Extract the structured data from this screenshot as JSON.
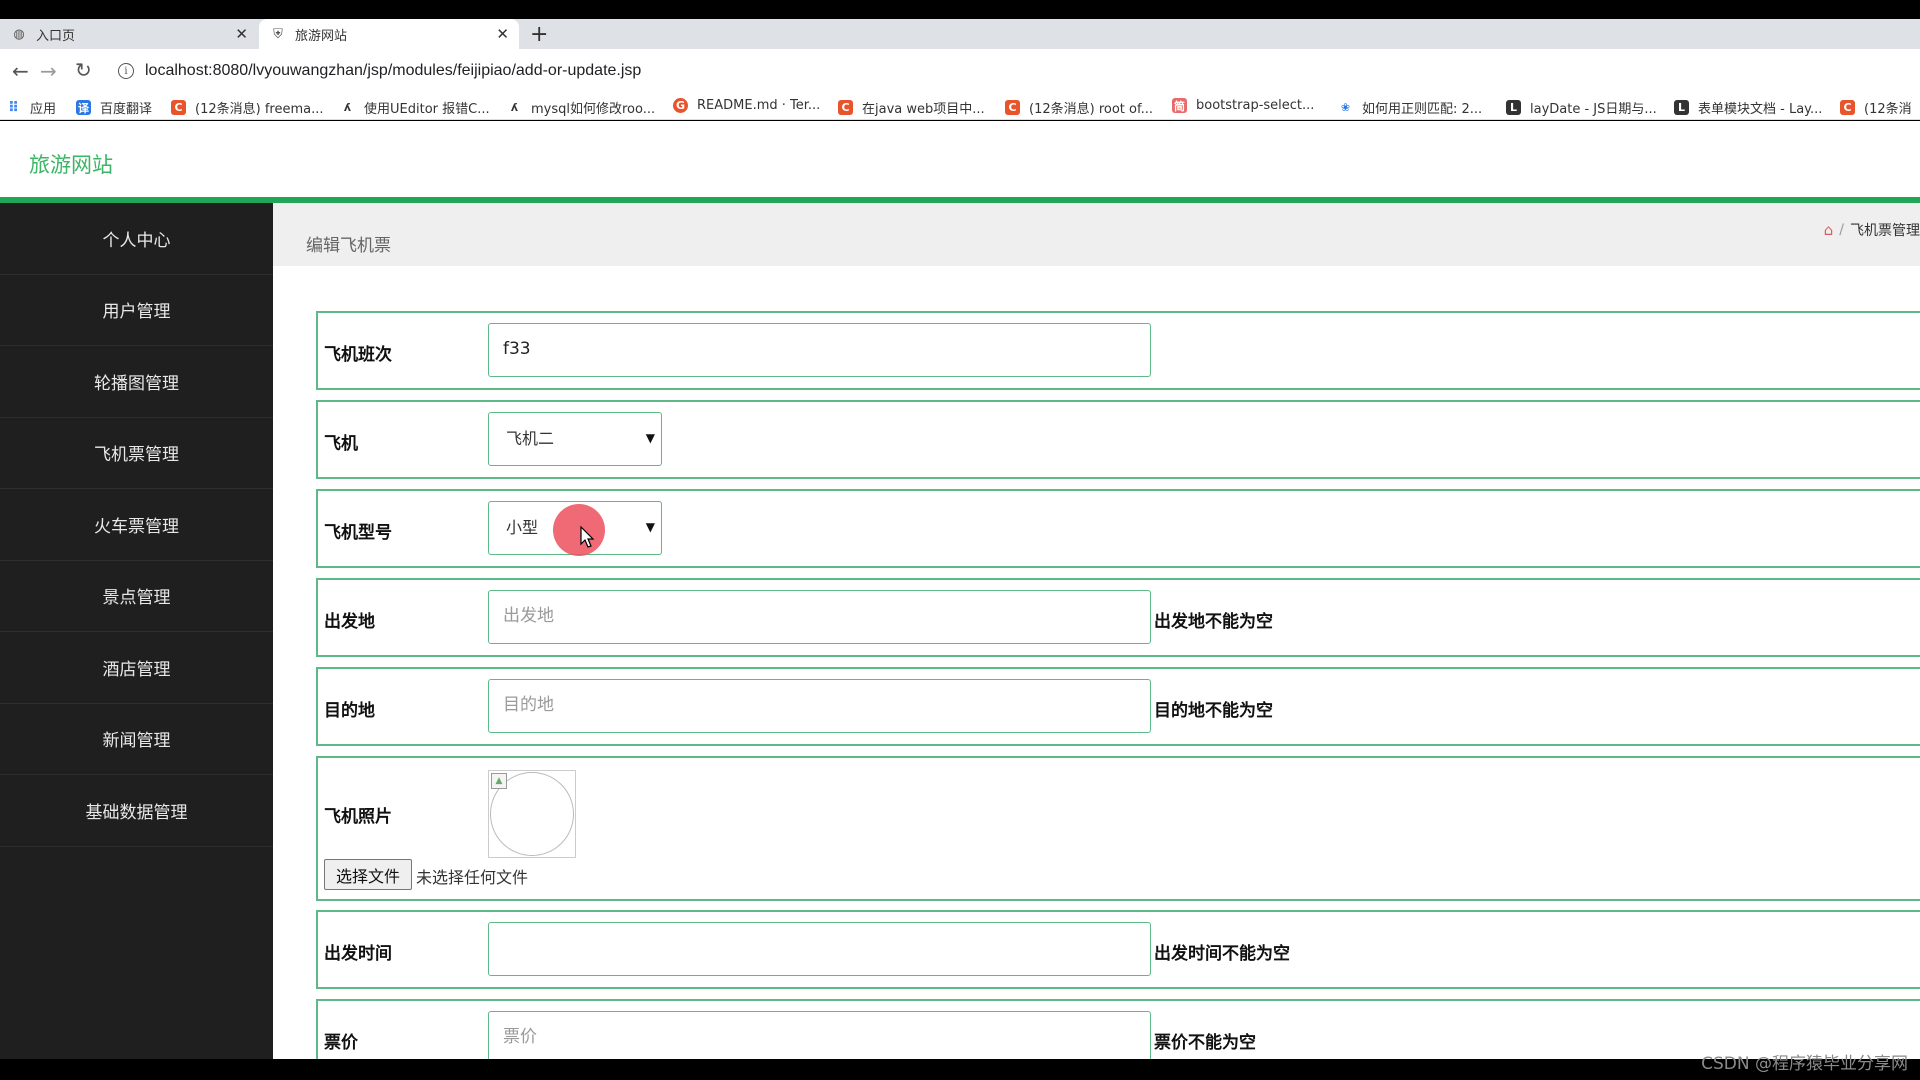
{
  "browser": {
    "tabs": [
      {
        "title": "入口页",
        "icon": "globe-icon"
      },
      {
        "title": "旅游网站",
        "icon": "shield-icon"
      }
    ],
    "new_tab": "+",
    "close_glyph": "✕",
    "url": "localhost:8080/lvyouwangzhan/jsp/modules/feijipiao/add-or-update.jsp",
    "bookmarks": [
      {
        "label": "应用",
        "icon": "apps-grid-icon"
      },
      {
        "label": "百度翻译",
        "icon": "baidu-translate-icon"
      },
      {
        "label": "(12条消息) freema...",
        "icon": "csdn-icon"
      },
      {
        "label": "使用UEditor 报错C...",
        "icon": "link-icon"
      },
      {
        "label": "mysql如何修改roo...",
        "icon": "link-icon"
      },
      {
        "label": "README.md · Ter...",
        "icon": "gitee-icon"
      },
      {
        "label": "在java web项目中...",
        "icon": "csdn-icon"
      },
      {
        "label": "(12条消息) root of...",
        "icon": "csdn-icon"
      },
      {
        "label": "bootstrap-select...",
        "icon": "doc-icon"
      },
      {
        "label": "如何用正则匹配: 2...",
        "icon": "baidu-icon"
      },
      {
        "label": "layDate - JS日期与...",
        "icon": "layui-icon"
      },
      {
        "label": "表单模块文档 - Lay...",
        "icon": "layui-icon"
      },
      {
        "label": "(12条消",
        "icon": "csdn-icon"
      }
    ]
  },
  "app": {
    "logo": "旅游网站",
    "sidebar": [
      "个人中心",
      "用户管理",
      "轮播图管理",
      "飞机票管理",
      "火车票管理",
      "景点管理",
      "酒店管理",
      "新闻管理",
      "基础数据管理"
    ],
    "page_title": "编辑飞机票",
    "breadcrumb": {
      "separator": "/",
      "current": "飞机票管理"
    },
    "form": {
      "flight_no": {
        "label": "飞机班次",
        "value": "f33"
      },
      "plane": {
        "label": "飞机",
        "selected": "飞机二"
      },
      "plane_type": {
        "label": "飞机型号",
        "selected": "小型"
      },
      "departure": {
        "label": "出发地",
        "placeholder": "出发地",
        "error": "出发地不能为空"
      },
      "destination": {
        "label": "目的地",
        "placeholder": "目的地",
        "error": "目的地不能为空"
      },
      "photo": {
        "label": "飞机照片",
        "button": "选择文件",
        "status": "未选择任何文件"
      },
      "depart_time": {
        "label": "出发时间",
        "value": "",
        "error": "出发时间不能为空"
      },
      "price": {
        "label": "票价",
        "placeholder": "票价",
        "error": "票价不能为空"
      }
    }
  },
  "colors": {
    "accent_green": "#21a657",
    "logo_green": "#3bb566",
    "sidebar_bg": "#1f1f1f",
    "click_marker": "#ec505c"
  },
  "watermark": "CSDN @程序猿毕业分享网"
}
